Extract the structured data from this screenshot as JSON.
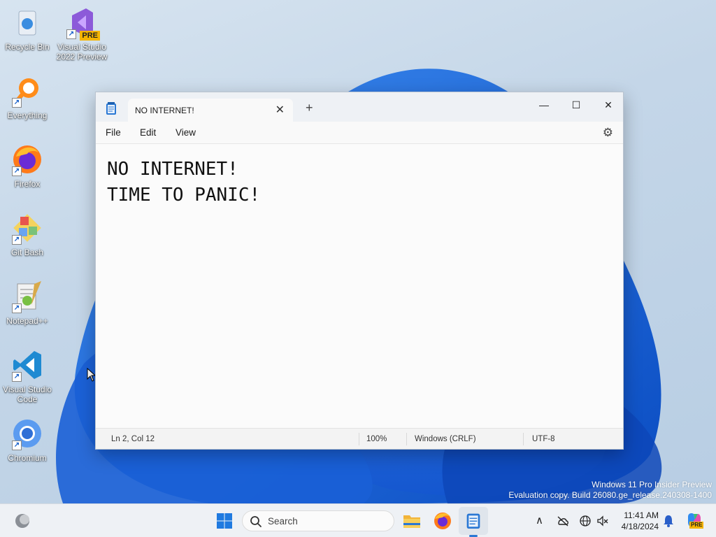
{
  "desktop": {
    "icons": [
      {
        "label": "Recycle Bin"
      },
      {
        "label": "Visual Studio 2022 Preview",
        "badge": "PRE"
      },
      {
        "label": "Everything"
      },
      {
        "label": "Firefox"
      },
      {
        "label": "Git Bash"
      },
      {
        "label": "Notepad++"
      },
      {
        "label": "Visual Studio Code"
      },
      {
        "label": "Chromium"
      }
    ]
  },
  "notepad": {
    "tab_title": "NO INTERNET!",
    "close_tab_glyph": "✕",
    "new_tab_glyph": "+",
    "minimize_glyph": "—",
    "maximize_glyph": "☐",
    "close_glyph": "✕",
    "menu": {
      "file": "File",
      "edit": "Edit",
      "view": "View"
    },
    "settings_glyph": "⚙",
    "content": {
      "line1": "NO INTERNET!",
      "line2": "TIME TO PANIC!"
    },
    "status": {
      "position": "Ln 2, Col 12",
      "zoom": "100%",
      "line_ending": "Windows (CRLF)",
      "encoding": "UTF-8"
    }
  },
  "watermark": {
    "line1": "Windows 11 Pro Insider Preview",
    "line2": "Evaluation copy. Build 26080.ge_release.240308-1400"
  },
  "taskbar": {
    "search_placeholder": "Search",
    "tray_chevron": "∧",
    "time": "11:41 AM",
    "date": "4/18/2024",
    "copilot_badge": "PRE"
  },
  "colors": {
    "accent": "#2a78d4",
    "wallpaper_blue": "#1b6fe0"
  }
}
